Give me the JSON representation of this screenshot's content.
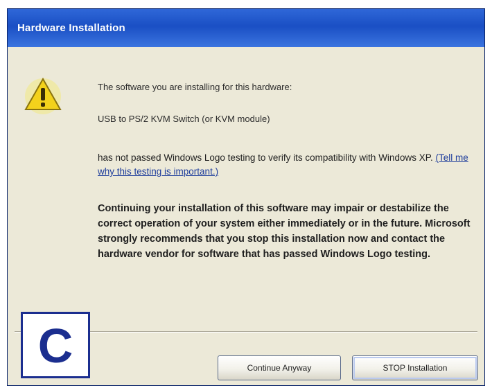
{
  "dialog": {
    "title": "Hardware Installation",
    "line1": "The software you are installing for this hardware:",
    "line2": "USB to PS/2 KVM Switch (or KVM module)",
    "para1_prefix": "has not passed Windows Logo testing to verify its compatibility with Windows XP.",
    "para1_link": "(Tell me why this testing is important.)",
    "para2": "Continuing your installation of this software may impair or destabilize the correct operation of your system either immediately or in the future. Microsoft strongly recommends that you stop this installation now and contact the hardware vendor for software that has passed Windows Logo testing.",
    "buttons": {
      "continue": "Continue Anyway",
      "stop": "STOP Installation"
    }
  },
  "badge": {
    "label": "C"
  },
  "colors": {
    "titlebar": "#1a4fc4",
    "face": "#ece9d8",
    "badge": "#1b2e8f"
  }
}
